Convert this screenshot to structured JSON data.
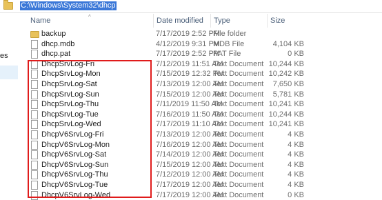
{
  "address_bar": {
    "path": "C:\\Windows\\System32\\dhcp",
    "icon": "folder-icon"
  },
  "nav_pane": {
    "partial_text": "es"
  },
  "columns": {
    "name": "Name",
    "date_modified": "Date modified",
    "type": "Type",
    "size": "Size"
  },
  "files": [
    {
      "name": "backup",
      "date": "7/17/2019 2:52 PM",
      "type": "File folder",
      "size": "",
      "icon": "folder-icon"
    },
    {
      "name": "dhcp.mdb",
      "date": "4/12/2019 9:31 PM",
      "type": "MDB File",
      "size": "4,104 KB",
      "icon": "file-icon"
    },
    {
      "name": "dhcp.pat",
      "date": "7/17/2019 2:52 PM",
      "type": "PAT File",
      "size": "0 KB",
      "icon": "file-icon"
    },
    {
      "name": "DhcpSrvLog-Fri",
      "date": "7/12/2019 11:51 AM",
      "type": "Text Document",
      "size": "10,244 KB",
      "icon": "text-document-icon"
    },
    {
      "name": "DhcpSrvLog-Mon",
      "date": "7/15/2019 12:32 PM",
      "type": "Text Document",
      "size": "10,242 KB",
      "icon": "text-document-icon"
    },
    {
      "name": "DhcpSrvLog-Sat",
      "date": "7/13/2019 12:00 AM",
      "type": "Text Document",
      "size": "7,650 KB",
      "icon": "text-document-icon"
    },
    {
      "name": "DhcpSrvLog-Sun",
      "date": "7/15/2019 12:00 AM",
      "type": "Text Document",
      "size": "5,781 KB",
      "icon": "text-document-icon"
    },
    {
      "name": "DhcpSrvLog-Thu",
      "date": "7/11/2019 11:50 AM",
      "type": "Text Document",
      "size": "10,241 KB",
      "icon": "text-document-icon"
    },
    {
      "name": "DhcpSrvLog-Tue",
      "date": "7/16/2019 11:50 AM",
      "type": "Text Document",
      "size": "10,244 KB",
      "icon": "text-document-icon"
    },
    {
      "name": "DhcpSrvLog-Wed",
      "date": "7/17/2019 11:10 AM",
      "type": "Text Document",
      "size": "10,241 KB",
      "icon": "text-document-icon"
    },
    {
      "name": "DhcpV6SrvLog-Fri",
      "date": "7/13/2019 12:00 AM",
      "type": "Text Document",
      "size": "4 KB",
      "icon": "text-document-icon"
    },
    {
      "name": "DhcpV6SrvLog-Mon",
      "date": "7/16/2019 12:00 AM",
      "type": "Text Document",
      "size": "4 KB",
      "icon": "text-document-icon"
    },
    {
      "name": "DhcpV6SrvLog-Sat",
      "date": "7/14/2019 12:00 AM",
      "type": "Text Document",
      "size": "4 KB",
      "icon": "text-document-icon"
    },
    {
      "name": "DhcpV6SrvLog-Sun",
      "date": "7/15/2019 12:00 AM",
      "type": "Text Document",
      "size": "4 KB",
      "icon": "text-document-icon"
    },
    {
      "name": "DhcpV6SrvLog-Thu",
      "date": "7/12/2019 12:00 AM",
      "type": "Text Document",
      "size": "4 KB",
      "icon": "text-document-icon"
    },
    {
      "name": "DhcpV6SrvLog-Tue",
      "date": "7/17/2019 12:00 AM",
      "type": "Text Document",
      "size": "4 KB",
      "icon": "text-document-icon"
    },
    {
      "name": "DhcpV6SrvLog-Wed",
      "date": "7/17/2019 12:00 AM",
      "type": "Text Document",
      "size": "0 KB",
      "icon": "text-document-icon"
    }
  ],
  "colors": {
    "selection": "#3b78d8",
    "highlight_box": "#e01b1b",
    "header_text": "#4c607a"
  }
}
